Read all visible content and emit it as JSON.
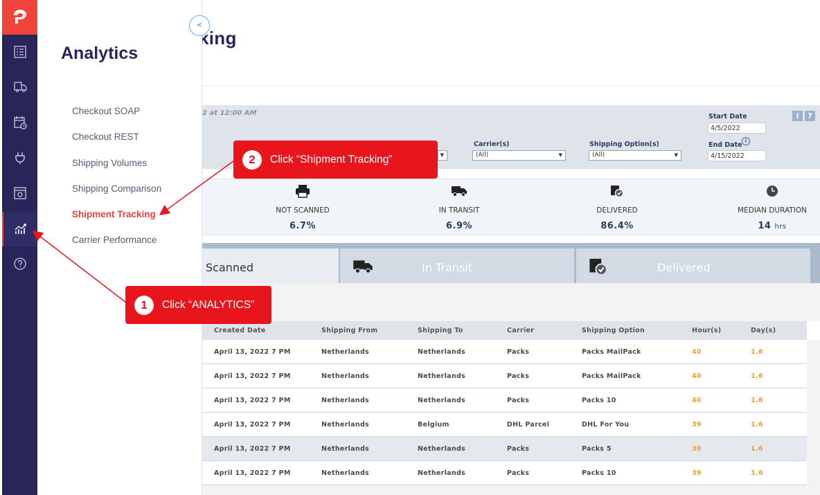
{
  "page": {
    "title_fragment": "king"
  },
  "flyout": {
    "title": "Analytics",
    "collapse_label": "<",
    "items": [
      {
        "label": "Checkout SOAP"
      },
      {
        "label": "Checkout REST"
      },
      {
        "label": "Shipping Volumes"
      },
      {
        "label": "Shipping Comparison"
      },
      {
        "label": "Shipment Tracking",
        "active": true
      },
      {
        "label": "Carrier Performance"
      }
    ]
  },
  "filters": {
    "time_fragment": "2 at 12:00 AM",
    "carrier_label": "Carrier(s)",
    "carrier_value": "(All)",
    "shipping_option_label": "Shipping Option(s)",
    "shipping_option_value": "(All)",
    "start_date_label": "Start Date",
    "start_date_value": "4/5/2022",
    "end_date_label": "End Date",
    "end_date_value": "4/15/2022",
    "info_btn": "i",
    "help_btn": "?"
  },
  "stats": [
    {
      "label": "NOT SCANNED",
      "value": "6.7%",
      "icon": "printer-icon"
    },
    {
      "label": "IN TRANSIT",
      "value": "6.9%",
      "icon": "truck-icon"
    },
    {
      "label": "DELIVERED",
      "value": "86.4%",
      "icon": "package-check-icon"
    },
    {
      "label": "MEDIAN DURATION",
      "value": "14",
      "unit": "hrs",
      "icon": "clock-icon"
    }
  ],
  "tabs": [
    {
      "label": "Scanned"
    },
    {
      "label": "In Transit"
    },
    {
      "label": "Delivered"
    }
  ],
  "table": {
    "columns": [
      "Created Date",
      "Shipping From",
      "Shipping To",
      "Carrier",
      "Shipping Option",
      "Hour(s)",
      "Day(s)"
    ],
    "rows": [
      [
        "April 13, 2022 7 PM",
        "Netherlands",
        "Netherlands",
        "Packs",
        "Packs MailPack",
        "40",
        "1.6"
      ],
      [
        "April 13, 2022 7 PM",
        "Netherlands",
        "Netherlands",
        "Packs",
        "Packs MailPack",
        "40",
        "1.6"
      ],
      [
        "April 13, 2022 7 PM",
        "Netherlands",
        "Netherlands",
        "Packs",
        "Packs 10",
        "40",
        "1.6"
      ],
      [
        "April 13, 2022 7 PM",
        "Netherlands",
        "Belgium",
        "DHL Parcel",
        "DHL For You",
        "39",
        "1.6"
      ],
      [
        "April 13, 2022 7 PM",
        "Netherlands",
        "Netherlands",
        "Packs",
        "Packs 5",
        "39",
        "1.6"
      ],
      [
        "April 13, 2022 7 PM",
        "Netherlands",
        "Netherlands",
        "Packs",
        "Packs 10",
        "39",
        "1.6"
      ]
    ]
  },
  "callouts": [
    {
      "num": "1",
      "text": "Click “ANALYTICS”"
    },
    {
      "num": "2",
      "text": "Click “Shipment Tracking”"
    }
  ],
  "colors": {
    "rail": "#27255a",
    "brand": "#f0433a",
    "callout": "#e8151d",
    "active_link": "#e8413c"
  }
}
